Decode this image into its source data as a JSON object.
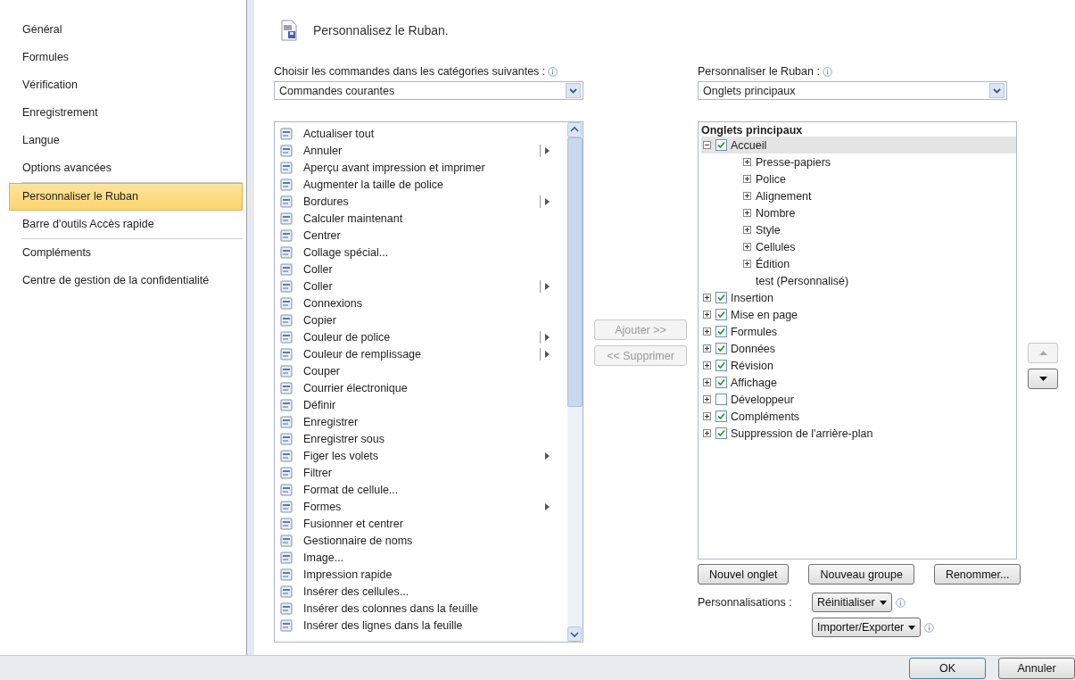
{
  "sidebar": {
    "groups": [
      [
        {
          "label": "Général",
          "selected": false
        },
        {
          "label": "Formules",
          "selected": false
        },
        {
          "label": "Vérification",
          "selected": false
        },
        {
          "label": "Enregistrement",
          "selected": false
        },
        {
          "label": "Langue",
          "selected": false
        },
        {
          "label": "Options avancées",
          "selected": false
        }
      ],
      [
        {
          "label": "Personnaliser le Ruban",
          "selected": true
        },
        {
          "label": "Barre d'outils Accès rapide",
          "selected": false
        }
      ],
      [
        {
          "label": "Compléments",
          "selected": false
        },
        {
          "label": "Centre de gestion de la confidentialité",
          "selected": false
        }
      ]
    ]
  },
  "header": {
    "title": "Personnalisez le Ruban."
  },
  "commands_panel": {
    "label": "Choisir les commandes dans les catégories suivantes :",
    "dropdown_value": "Commandes courantes",
    "items": [
      {
        "label": "Actualiser tout",
        "kind": "plain"
      },
      {
        "label": "Annuler",
        "kind": "split"
      },
      {
        "label": "Aperçu avant impression et imprimer",
        "kind": "plain"
      },
      {
        "label": "Augmenter la taille de police",
        "kind": "plain"
      },
      {
        "label": "Bordures",
        "kind": "split"
      },
      {
        "label": "Calculer maintenant",
        "kind": "plain"
      },
      {
        "label": "Centrer",
        "kind": "plain"
      },
      {
        "label": "Collage spécial...",
        "kind": "plain"
      },
      {
        "label": "Coller",
        "kind": "plain"
      },
      {
        "label": "Coller",
        "kind": "split"
      },
      {
        "label": "Connexions",
        "kind": "plain"
      },
      {
        "label": "Copier",
        "kind": "plain"
      },
      {
        "label": "Couleur de police",
        "kind": "split"
      },
      {
        "label": "Couleur de remplissage",
        "kind": "split"
      },
      {
        "label": "Couper",
        "kind": "plain"
      },
      {
        "label": "Courrier électronique",
        "kind": "plain"
      },
      {
        "label": "Définir",
        "kind": "plain"
      },
      {
        "label": "Enregistrer",
        "kind": "plain"
      },
      {
        "label": "Enregistrer sous",
        "kind": "plain"
      },
      {
        "label": "Figer les volets",
        "kind": "menu"
      },
      {
        "label": "Filtrer",
        "kind": "plain"
      },
      {
        "label": "Format de cellule...",
        "kind": "plain"
      },
      {
        "label": "Formes",
        "kind": "menu"
      },
      {
        "label": "Fusionner et centrer",
        "kind": "plain"
      },
      {
        "label": "Gestionnaire de noms",
        "kind": "plain"
      },
      {
        "label": "Image...",
        "kind": "plain"
      },
      {
        "label": "Impression rapide",
        "kind": "plain"
      },
      {
        "label": "Insérer des cellules...",
        "kind": "plain"
      },
      {
        "label": "Insérer des colonnes dans la feuille",
        "kind": "plain"
      },
      {
        "label": "Insérer des lignes dans la feuille",
        "kind": "plain"
      }
    ]
  },
  "transfer_buttons": [
    {
      "label": "Ajouter >>",
      "disabled": true
    },
    {
      "label": "<< Supprimer",
      "disabled": true
    }
  ],
  "ribbon_panel": {
    "label": "Personnaliser le Ruban :",
    "dropdown_value": "Onglets principaux",
    "tree_header": "Onglets principaux",
    "tabs": [
      {
        "label": "Accueil",
        "checked": true,
        "expanded": true,
        "selected": true,
        "children": [
          {
            "label": "Presse-papiers",
            "expandable": true
          },
          {
            "label": "Police",
            "expandable": true
          },
          {
            "label": "Alignement",
            "expandable": true
          },
          {
            "label": "Nombre",
            "expandable": true
          },
          {
            "label": "Style",
            "expandable": true
          },
          {
            "label": "Cellules",
            "expandable": true
          },
          {
            "label": "Édition",
            "expandable": true
          },
          {
            "label": "test (Personnalisé)",
            "expandable": false
          }
        ]
      },
      {
        "label": "Insertion",
        "checked": true,
        "expanded": false,
        "selected": false
      },
      {
        "label": "Mise en page",
        "checked": true,
        "expanded": false,
        "selected": false
      },
      {
        "label": "Formules",
        "checked": true,
        "expanded": false,
        "selected": false
      },
      {
        "label": "Données",
        "checked": true,
        "expanded": false,
        "selected": false
      },
      {
        "label": "Révision",
        "checked": true,
        "expanded": false,
        "selected": false
      },
      {
        "label": "Affichage",
        "checked": true,
        "expanded": false,
        "selected": false
      },
      {
        "label": "Développeur",
        "checked": false,
        "expanded": false,
        "selected": false
      },
      {
        "label": "Compléments",
        "checked": true,
        "expanded": false,
        "selected": false
      },
      {
        "label": "Suppression de l'arrière-plan",
        "checked": true,
        "expanded": false,
        "selected": false
      }
    ],
    "move_buttons": [
      {
        "kind": "up",
        "disabled": true
      },
      {
        "kind": "down",
        "disabled": false
      }
    ],
    "buttons": [
      "Nouvel onglet",
      "Nouveau groupe",
      "Renommer..."
    ],
    "customizations_label": "Personnalisations :",
    "menu_buttons": [
      "Réinitialiser",
      "Importer/Exporter"
    ]
  },
  "footer_buttons": [
    "OK",
    "Annuler"
  ]
}
